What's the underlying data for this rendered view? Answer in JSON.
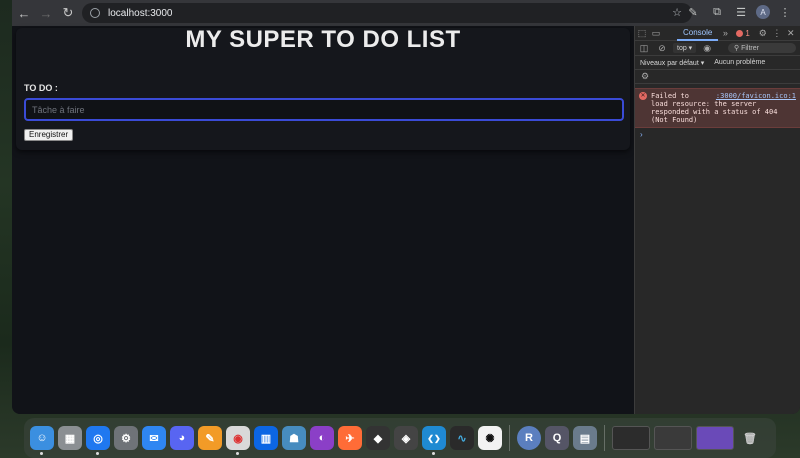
{
  "browser": {
    "url": "localhost:3000",
    "profile_initial": "A",
    "nav_icons": [
      "back-icon",
      "forward-icon",
      "reload-icon"
    ]
  },
  "page": {
    "title": "MY SUPER TO DO LIST",
    "todo_label": "TO DO :",
    "input_placeholder": "Tâche à faire",
    "input_value": "",
    "submit_label": "Enregistrer",
    "accent": "#3a4bd6"
  },
  "devtools": {
    "active_tab": "Console",
    "error_count": "1",
    "context": "top",
    "filter_placeholder": "Filtrer",
    "levels": "Niveaux par défaut",
    "issues": "Aucun problème",
    "error": {
      "line1": "Failed to",
      "source": ":3000/favicon.ico:1",
      "rest": "load resource: the server responded with a status of 404 (Not Found)"
    },
    "prompt": "›"
  },
  "dock": {
    "apps": [
      {
        "name": "finder",
        "color": "#3b8fe0",
        "glyph": "☺"
      },
      {
        "name": "launchpad",
        "color": "#8b8f93",
        "glyph": "▦"
      },
      {
        "name": "safari",
        "color": "#1f78f0",
        "glyph": "◎"
      },
      {
        "name": "system-settings",
        "color": "#6f7378",
        "glyph": "⚙"
      },
      {
        "name": "mail",
        "color": "#2f86f2",
        "glyph": "✉"
      },
      {
        "name": "discord",
        "color": "#5865f2",
        "glyph": "◕"
      },
      {
        "name": "pages",
        "color": "#f29b27",
        "glyph": "✎"
      },
      {
        "name": "chrome",
        "color": "#d9d9d9",
        "glyph": "◉"
      },
      {
        "name": "trello",
        "color": "#0c66e4",
        "glyph": "▥"
      },
      {
        "name": "godot",
        "color": "#478cbf",
        "glyph": "☗"
      },
      {
        "name": "github-desktop",
        "color": "#8b3fc7",
        "glyph": "◐"
      },
      {
        "name": "postman",
        "color": "#ff6c37",
        "glyph": "✈"
      },
      {
        "name": "unity",
        "color": "#333",
        "glyph": "◆"
      },
      {
        "name": "unity-hub",
        "color": "#444",
        "glyph": "◈"
      },
      {
        "name": "vscode",
        "color": "#1f8ad2",
        "glyph": "❮❯"
      },
      {
        "name": "activity-monitor",
        "color": "#2a2a2a",
        "glyph": "∿"
      },
      {
        "name": "chatgpt",
        "color": "#f2f2f2",
        "glyph": "✺"
      },
      {
        "name": "r",
        "color": "#5b7fbf",
        "glyph": "R"
      },
      {
        "name": "quicktime",
        "color": "#556",
        "glyph": "Q"
      },
      {
        "name": "preview",
        "color": "#6a7b8c",
        "glyph": "▤"
      }
    ]
  }
}
